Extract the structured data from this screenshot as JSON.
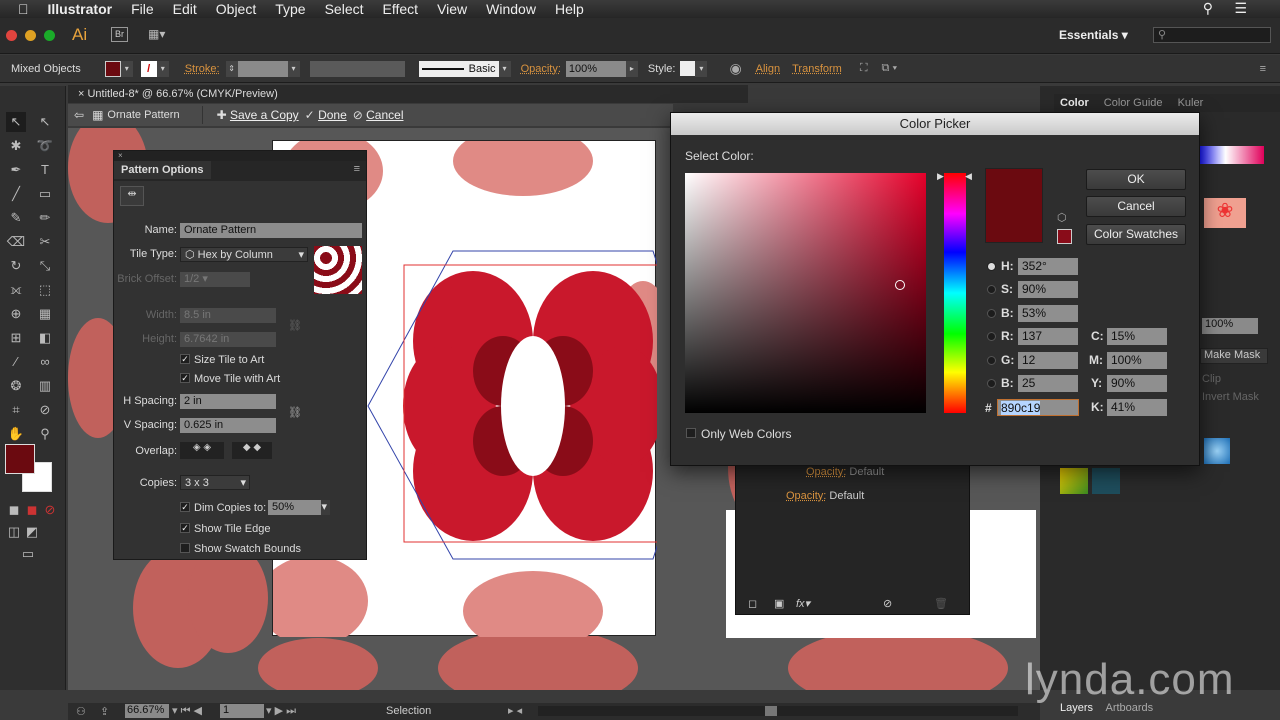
{
  "menubar": {
    "app": "Illustrator",
    "items": [
      "File",
      "Edit",
      "Object",
      "Type",
      "Select",
      "Effect",
      "View",
      "Window",
      "Help"
    ]
  },
  "appbar": {
    "logo": "Ai",
    "bridge": "Br",
    "workspace": "Essentials"
  },
  "control": {
    "selection": "Mixed Objects",
    "stroke_label": "Stroke:",
    "brush": "Basic",
    "opacity_label": "Opacity:",
    "opacity": "100%",
    "style_label": "Style:",
    "align": "Align",
    "transform": "Transform",
    "fill_color": "#6b0a10"
  },
  "document": {
    "tab": "Untitled-8* @ 66.67% (CMYK/Preview)"
  },
  "pattern_edit": {
    "name": "Ornate Pattern",
    "save_copy": "Save a Copy",
    "done": "Done",
    "cancel": "Cancel"
  },
  "pattern_options": {
    "title": "Pattern Options",
    "name_label": "Name:",
    "name": "Ornate Pattern",
    "tile_type_label": "Tile Type:",
    "tile_type": "Hex by Column",
    "brick_label": "Brick Offset:",
    "brick": "1/2",
    "width_label": "Width:",
    "width": "8.5 in",
    "height_label": "Height:",
    "height": "6.7642 in",
    "size_tile": "Size Tile to Art",
    "move_tile": "Move Tile with Art",
    "h_label": "H Spacing:",
    "h": "2 in",
    "v_label": "V Spacing:",
    "v": "0.625 in",
    "overlap_label": "Overlap:",
    "copies_label": "Copies:",
    "copies": "3 x 3",
    "dim_label": "Dim Copies to:",
    "dim": "50%",
    "show_edge": "Show Tile Edge",
    "show_bounds": "Show Swatch Bounds"
  },
  "color_picker": {
    "title": "Color Picker",
    "select": "Select Color:",
    "ok": "OK",
    "cancel": "Cancel",
    "swatches": "Color Swatches",
    "only_web": "Only Web Colors",
    "color": "#890c19",
    "fields": {
      "H": "352°",
      "S": "90%",
      "B": "53%",
      "R": "137",
      "G": "12",
      "B2": "25",
      "C": "15%",
      "M": "100%",
      "Y": "90%",
      "K": "41%",
      "hex": "890c19"
    },
    "labels": {
      "H": "H:",
      "S": "S:",
      "B": "B:",
      "R": "R:",
      "G": "G:",
      "B2": "B:",
      "C": "C:",
      "M": "M:",
      "Y": "Y:",
      "K": "K:",
      "hash": "#"
    }
  },
  "right_panels": {
    "tabs": [
      "Color",
      "Color Guide",
      "Kuler"
    ],
    "opacity": "100%",
    "make_mask": "Make Mask",
    "clip": "Clip",
    "invert": "Invert Mask",
    "bottom_tabs": [
      "Layers",
      "Artboards"
    ]
  },
  "layers_panel": {
    "row1_label": "Opacity:",
    "row1_value": "Default",
    "row2_label": "Opacity:",
    "row2_value": "Default"
  },
  "status": {
    "zoom": "66.67%",
    "page": "1",
    "tool": "Selection"
  },
  "watermark": "lynda.com"
}
